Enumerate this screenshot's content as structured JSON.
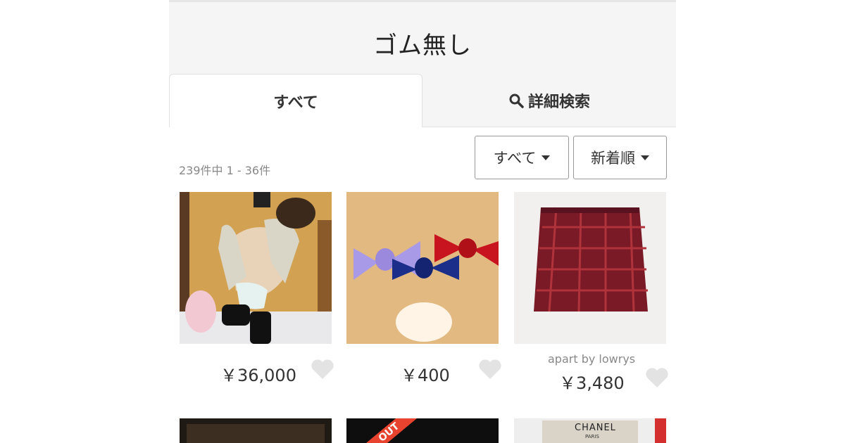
{
  "header": {
    "title": "ゴム無し"
  },
  "tabs": [
    {
      "label": "すべて"
    },
    {
      "label": "詳細検索"
    }
  ],
  "results": {
    "count_text": "239件中 1 - 36件"
  },
  "filters": {
    "category": "すべて",
    "sort": "新着順"
  },
  "items": [
    {
      "price": "￥36,000",
      "brand": ""
    },
    {
      "price": "￥400",
      "brand": ""
    },
    {
      "price": "￥3,480",
      "brand": "apart by lowrys"
    }
  ],
  "row2": {
    "item2_tag": "OUT",
    "item3_text": "CHANEL",
    "item3_subtext": "PARIS"
  },
  "colors": {
    "heart": "#e3e3e3",
    "header_bg": "#f6f5f6"
  },
  "icons": [
    "search-icon",
    "caret-down-icon",
    "heart-icon"
  ]
}
